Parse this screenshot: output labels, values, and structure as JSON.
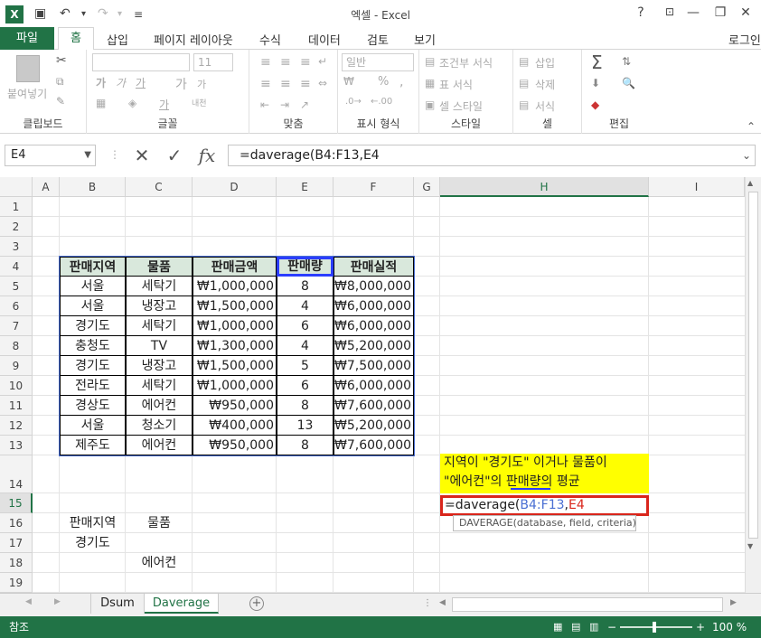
{
  "app": {
    "logo_text": "X",
    "title": "엑셀 - Excel",
    "help": "?",
    "minimize": "—",
    "restore": "❐",
    "close": "✕"
  },
  "quick_access": {
    "save": "💾",
    "undo": "↶",
    "redo": "↷",
    "customize": "≡"
  },
  "tabs": [
    "파일",
    "홈",
    "삽입",
    "페이지 레이아웃",
    "수식",
    "데이터",
    "검토",
    "보기"
  ],
  "signin": "로그인",
  "ribbon": {
    "clipboard": {
      "paste": "붙여넣기",
      "label": "클립보드"
    },
    "font": {
      "size": "11",
      "bold": "가",
      "italic": "가",
      "underline": "가",
      "grow": "가",
      "shrink": "가",
      "label": "글꼴"
    },
    "align": {
      "wrap": "내천",
      "label": "맞춤"
    },
    "number": {
      "format": "일반",
      "pct": "%",
      "comma": ",",
      "label": "표시 형식"
    },
    "styles": {
      "cond": "조건부 서식",
      "table": "표 서식",
      "cell": "셀 스타일",
      "label": "스타일"
    },
    "cells": {
      "insert": "삽입",
      "delete": "삭제",
      "format": "서식",
      "label": "셀"
    },
    "edit": {
      "label": "편집"
    }
  },
  "formula_bar": {
    "name_box": "E4",
    "formula": "=daverage(B4:F13,E4",
    "cancel": "✕",
    "enter": "✓",
    "fx": "fx"
  },
  "columns": [
    "A",
    "B",
    "C",
    "D",
    "E",
    "F",
    "G",
    "H",
    "I"
  ],
  "rows": [
    "1",
    "2",
    "3",
    "4",
    "5",
    "6",
    "7",
    "8",
    "9",
    "10",
    "11",
    "12",
    "13",
    "14",
    "15",
    "16",
    "17",
    "18",
    "19"
  ],
  "table": {
    "headers": [
      "판매지역",
      "물품",
      "판매금액",
      "판매량",
      "판매실적"
    ],
    "rows": [
      [
        "서울",
        "세탁기",
        "₩1,000,000",
        "8",
        "₩8,000,000"
      ],
      [
        "서울",
        "냉장고",
        "₩1,500,000",
        "4",
        "₩6,000,000"
      ],
      [
        "경기도",
        "세탁기",
        "₩1,000,000",
        "6",
        "₩6,000,000"
      ],
      [
        "충청도",
        "TV",
        "₩1,300,000",
        "4",
        "₩5,200,000"
      ],
      [
        "경기도",
        "냉장고",
        "₩1,500,000",
        "5",
        "₩7,500,000"
      ],
      [
        "전라도",
        "세탁기",
        "₩1,000,000",
        "6",
        "₩6,000,000"
      ],
      [
        "경상도",
        "에어컨",
        "₩950,000",
        "8",
        "₩7,600,000"
      ],
      [
        "서울",
        "청소기",
        "₩400,000",
        "13",
        "₩5,200,000"
      ],
      [
        "제주도",
        "에어컨",
        "₩950,000",
        "8",
        "₩7,600,000"
      ]
    ]
  },
  "criteria": {
    "h1": "판매지역",
    "h2": "물품",
    "v1": "경기도",
    "v2": "에어컨"
  },
  "note": {
    "line1": "지역이 \"경기도\" 이거나 물품이",
    "line2": "\"에어컨\"의 판매량의 평균"
  },
  "edit_cell": {
    "prefix": "=daverage(",
    "ref1": "B4:F13",
    "sep": ",",
    "ref2": "E4"
  },
  "tooltip": "DAVERAGE(database, field, criteria)",
  "sheets": [
    "Dsum",
    "Daverage"
  ],
  "status": {
    "mode": "참조",
    "zoom": "100 %"
  },
  "colors": {
    "accent": "#217346",
    "header_fill": "#d9e8dc",
    "note_fill": "#ffff00",
    "edit_border": "#d9261c"
  }
}
